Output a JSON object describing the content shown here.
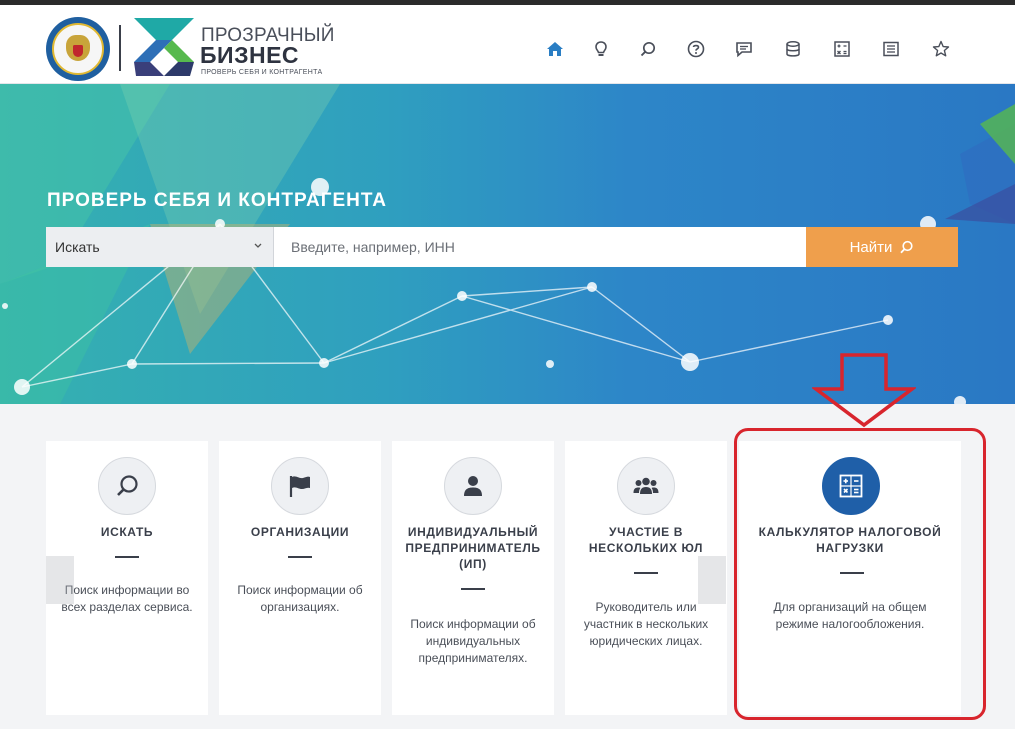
{
  "header": {
    "logo_line1": "ПРОЗРАЧНЫЙ",
    "logo_line2": "БИЗНЕС",
    "logo_tagline": "ПРОВЕРЬ СЕБЯ И КОНТРАГЕНТА",
    "emblem_text": "ФЕДЕРАЛЬНАЯ НАЛОГОВАЯ СЛУЖБА",
    "nav_icons": [
      "home-icon",
      "lightbulb-icon",
      "search-icon",
      "help-icon",
      "chat-icon",
      "database-icon",
      "calculator-icon",
      "list-icon",
      "star-icon"
    ]
  },
  "hero": {
    "title": "ПРОВЕРЬ СЕБЯ И КОНТРАГЕНТА",
    "search": {
      "select_value": "Искать",
      "input_placeholder": "Введите, например, ИНН",
      "button_label": "Найти"
    }
  },
  "cards": [
    {
      "icon": "search-icon",
      "title": "ИСКАТЬ",
      "desc": "Поиск информации во всех разделах сервиса."
    },
    {
      "icon": "flag-icon",
      "title": "ОРГАНИЗАЦИИ",
      "desc": "Поиск информации об организациях."
    },
    {
      "icon": "person-icon",
      "title": "ИНДИВИДУАЛЬНЫЙ ПРЕДПРИНИМАТЕЛЬ (ИП)",
      "desc": "Поиск информации об индивидуальных предпринимателях."
    },
    {
      "icon": "group-icon",
      "title": "УЧАСТИЕ В НЕСКОЛЬКИХ ЮЛ",
      "desc": "Руководитель или участник в нескольких юридических лицах."
    },
    {
      "icon": "calculator-icon",
      "title": "КАЛЬКУЛЯТОР НАЛОГОВОЙ НАГРУЗКИ",
      "desc": "Для организаций на общем режиме налогообложения."
    }
  ],
  "colors": {
    "accent_orange": "#ef9f4c",
    "brand_blue": "#1f5fa8",
    "highlight_red": "#d8252d"
  }
}
